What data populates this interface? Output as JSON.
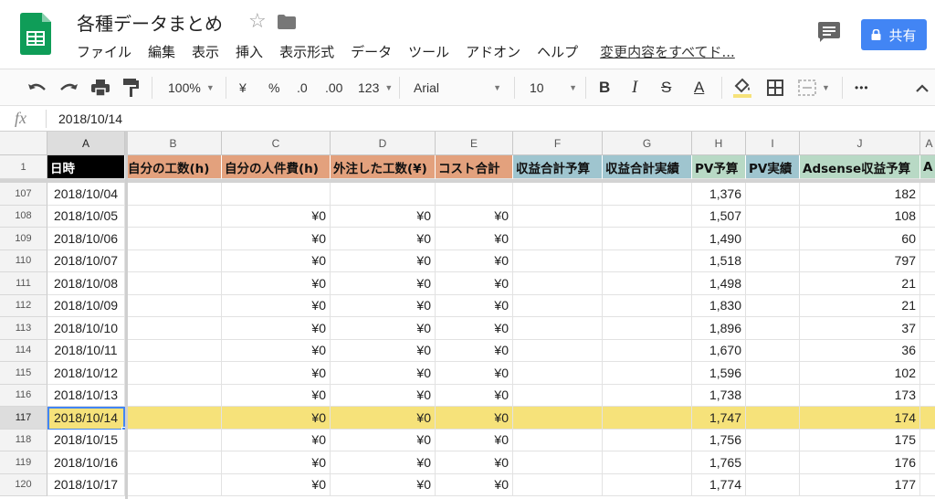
{
  "doc": {
    "title": "各種データまとめ",
    "last_edit": "変更内容をすべてド...",
    "share_label": "共有"
  },
  "menu": [
    "ファイル",
    "編集",
    "表示",
    "挿入",
    "表示形式",
    "データ",
    "ツール",
    "アドオン",
    "ヘルプ"
  ],
  "toolbar": {
    "zoom": "100%",
    "currency": "¥",
    "percent": "%",
    "dec_decrease": ".0",
    "dec_increase": ".00",
    "more_formats": "123",
    "font": "Arial",
    "font_size": "10",
    "bold": "B",
    "italic": "I",
    "strike": "S",
    "text_color": "A",
    "more": "•••"
  },
  "formula_bar": {
    "fx": "fx",
    "value": "2018/10/14"
  },
  "columns": [
    "A",
    "B",
    "C",
    "D",
    "E",
    "F",
    "G",
    "H",
    "I",
    "J",
    "A"
  ],
  "header_row_number": "1",
  "headers": [
    "日時",
    "自分の工数(h)",
    "自分の人件費(h)",
    "外注した工数(¥)",
    "コスト合計",
    "収益合計予算",
    "収益合計実績",
    "PV予算",
    "PV実績",
    "Adsense収益予算",
    "A"
  ],
  "header_colors": [
    "#000000",
    "#e3a17d",
    "#e3a17d",
    "#e3a17d",
    "#e3a17d",
    "#9fc5cf",
    "#9fc5cf",
    "#b8d9c5",
    "#9fc5cf",
    "#b8d9c5",
    "#b8d9c5"
  ],
  "highlight_color": "#f6e27a",
  "selected_row": "117",
  "rows": [
    {
      "n": "107",
      "date": "2018/10/04",
      "c": "",
      "d": "",
      "e": "",
      "h": "1,376",
      "j": "182"
    },
    {
      "n": "108",
      "date": "2018/10/05",
      "c": "¥0",
      "d": "¥0",
      "e": "¥0",
      "h": "1,507",
      "j": "108"
    },
    {
      "n": "109",
      "date": "2018/10/06",
      "c": "¥0",
      "d": "¥0",
      "e": "¥0",
      "h": "1,490",
      "j": "60"
    },
    {
      "n": "110",
      "date": "2018/10/07",
      "c": "¥0",
      "d": "¥0",
      "e": "¥0",
      "h": "1,518",
      "j": "797"
    },
    {
      "n": "111",
      "date": "2018/10/08",
      "c": "¥0",
      "d": "¥0",
      "e": "¥0",
      "h": "1,498",
      "j": "21"
    },
    {
      "n": "112",
      "date": "2018/10/09",
      "c": "¥0",
      "d": "¥0",
      "e": "¥0",
      "h": "1,830",
      "j": "21"
    },
    {
      "n": "113",
      "date": "2018/10/10",
      "c": "¥0",
      "d": "¥0",
      "e": "¥0",
      "h": "1,896",
      "j": "37"
    },
    {
      "n": "114",
      "date": "2018/10/11",
      "c": "¥0",
      "d": "¥0",
      "e": "¥0",
      "h": "1,670",
      "j": "36"
    },
    {
      "n": "115",
      "date": "2018/10/12",
      "c": "¥0",
      "d": "¥0",
      "e": "¥0",
      "h": "1,596",
      "j": "102"
    },
    {
      "n": "116",
      "date": "2018/10/13",
      "c": "¥0",
      "d": "¥0",
      "e": "¥0",
      "h": "1,738",
      "j": "173"
    },
    {
      "n": "117",
      "date": "2018/10/14",
      "c": "¥0",
      "d": "¥0",
      "e": "¥0",
      "h": "1,747",
      "j": "174"
    },
    {
      "n": "118",
      "date": "2018/10/15",
      "c": "¥0",
      "d": "¥0",
      "e": "¥0",
      "h": "1,756",
      "j": "175"
    },
    {
      "n": "119",
      "date": "2018/10/16",
      "c": "¥0",
      "d": "¥0",
      "e": "¥0",
      "h": "1,765",
      "j": "176"
    },
    {
      "n": "120",
      "date": "2018/10/17",
      "c": "¥0",
      "d": "¥0",
      "e": "¥0",
      "h": "1,774",
      "j": "177"
    }
  ]
}
